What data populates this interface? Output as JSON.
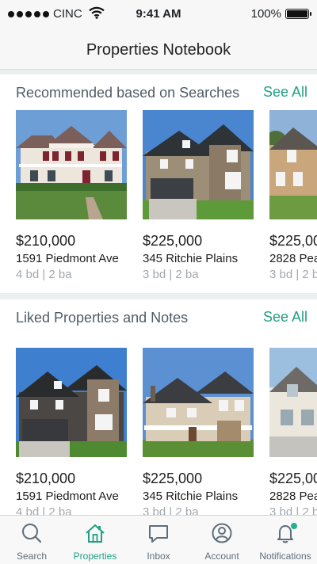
{
  "status": {
    "carrier": "CINC",
    "time": "9:41 AM",
    "battery": "100%",
    "battery_level": 1.0
  },
  "header": {
    "title": "Properties Notebook"
  },
  "recommended": {
    "title": "Recommended based on Searches",
    "see_all": "See All",
    "cards": [
      {
        "price": "$210,000",
        "address": "1591 Piedmont Ave",
        "beds": "4 bd | 2 ba"
      },
      {
        "price": "$225,000",
        "address": "345 Ritchie Plains",
        "beds": "3 bd | 2 ba"
      },
      {
        "price": "$225,00",
        "address": "2828 Pea",
        "beds": "3 bd | 2 b"
      }
    ]
  },
  "liked": {
    "title": "Liked Properties and Notes",
    "see_all": "See All",
    "cards": [
      {
        "price": "$210,000",
        "address": "1591 Piedmont Ave",
        "beds": "4 bd | 2 ba"
      },
      {
        "price": "$225,000",
        "address": "345 Ritchie Plains",
        "beds": "3 bd | 2 ba"
      },
      {
        "price": "$225,00",
        "address": "2828 Pea",
        "beds": "3 bd | 2 b"
      }
    ]
  },
  "tabs": [
    {
      "label": "Search",
      "icon": "search-icon"
    },
    {
      "label": "Properties",
      "icon": "home-icon"
    },
    {
      "label": "Inbox",
      "icon": "chat-icon"
    },
    {
      "label": "Account",
      "icon": "user-icon"
    },
    {
      "label": "Notifications",
      "icon": "bell-icon"
    }
  ],
  "colors": {
    "accent": "#21a083",
    "section_title": "#4f5c68",
    "muted": "#a3a8ad"
  }
}
